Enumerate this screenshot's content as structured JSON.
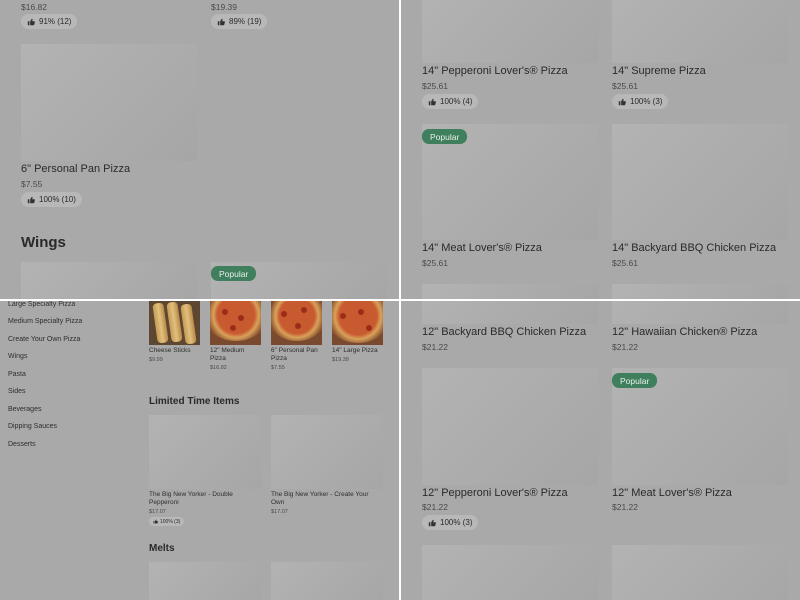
{
  "top_left": {
    "prev_items": [
      {
        "price": "$16.82",
        "rating": "91% (12)"
      },
      {
        "price": "$19.39",
        "rating": "89% (19)"
      }
    ],
    "personal_pan": {
      "name": "6\" Personal Pan Pizza",
      "price": "$7.55",
      "rating": "100% (10)"
    },
    "section_wings": "Wings",
    "badge_popular": "Popular"
  },
  "top_right": {
    "items": [
      {
        "name": "14\" Pepperoni Lover's® Pizza",
        "price": "$25.61",
        "rating": "100% (4)"
      },
      {
        "name": "14\" Supreme Pizza",
        "price": "$25.61",
        "rating": "100% (3)"
      },
      {
        "name": "14\" Meat Lover's® Pizza",
        "price": "$25.61",
        "badge": "Popular"
      },
      {
        "name": "14\" Backyard BBQ Chicken Pizza",
        "price": "$25.61"
      }
    ]
  },
  "bottom_right": {
    "items": [
      {
        "name": "12\" Backyard BBQ Chicken Pizza",
        "price": "$21.22"
      },
      {
        "name": "12\" Hawaiian Chicken® Pizza",
        "price": "$21.22"
      },
      {
        "name": "12\" Pepperoni Lover's® Pizza",
        "price": "$21.22",
        "rating": "100% (3)"
      },
      {
        "name": "12\" Meat Lover's® Pizza",
        "price": "$21.22",
        "badge": "Popular"
      }
    ]
  },
  "bottom_left": {
    "sidebar": [
      "Large Specialty Pizza",
      "Medium Specialty Pizza",
      "Create Your Own Pizza",
      "Wings",
      "Pasta",
      "Sides",
      "Beverages",
      "Dipping Sauces",
      "Desserts"
    ],
    "featured": [
      {
        "name": "Cheese Sticks",
        "price": "$9.99"
      },
      {
        "name": "12\" Medium Pizza",
        "price": "$16.82"
      },
      {
        "name": "6\" Personal Pan Pizza",
        "price": "$7.55"
      },
      {
        "name": "14\" Large Pizza",
        "price": "$19.39"
      }
    ],
    "limited_title": "Limited Time Items",
    "limited_items": [
      {
        "name": "The Big New Yorker - Double Pepperoni",
        "price": "$17.07",
        "rating": "100% (3)"
      },
      {
        "name": "The Big New Yorker - Create Your Own",
        "price": "$17.07"
      }
    ],
    "melts_title": "Melts"
  },
  "colors": {
    "popular_badge": "#3f7f5d",
    "background": "#a9a9a9",
    "divider": "#ffffff"
  }
}
